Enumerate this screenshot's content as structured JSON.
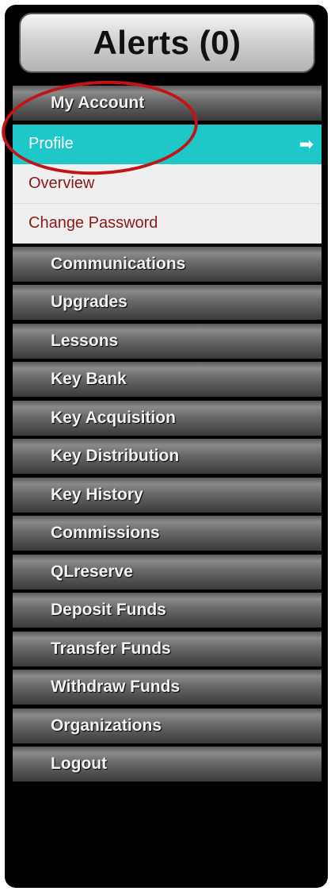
{
  "header": {
    "title": "Alerts (0)"
  },
  "menu": {
    "my_account": "My Account",
    "profile": "Profile",
    "profile_arrow": "➡",
    "overview": "Overview",
    "change_password": "Change Password",
    "items": [
      "Communications",
      "Upgrades",
      "Lessons",
      "Key Bank",
      "Key Acquisition",
      "Key Distribution",
      "Key History",
      "Commissions",
      "QLreserve",
      "Deposit Funds",
      "Transfer Funds",
      "Withdraw Funds",
      "Organizations",
      "Logout"
    ]
  },
  "colors": {
    "active": "#1ec8c8",
    "sub_text": "#8a1a1a",
    "annotation_circle": "#c21414"
  }
}
